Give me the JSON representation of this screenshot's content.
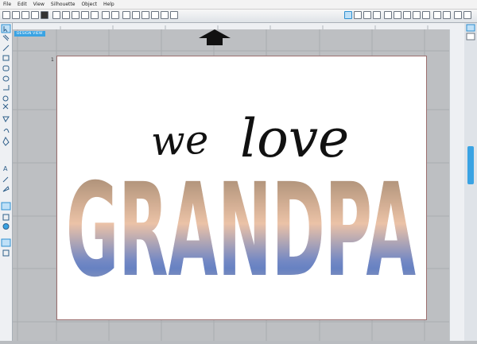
{
  "menu": [
    "File",
    "Edit",
    "View",
    "Silhouette",
    "Object",
    "Help"
  ],
  "design_view_label": "DESIGN VIEW",
  "page_number": "1",
  "design": {
    "line1": "we",
    "line2": "love",
    "title_word": "GRANDPA"
  },
  "colors": {
    "accent": "#3aa3e3",
    "page_border": "#9c6f6f"
  }
}
